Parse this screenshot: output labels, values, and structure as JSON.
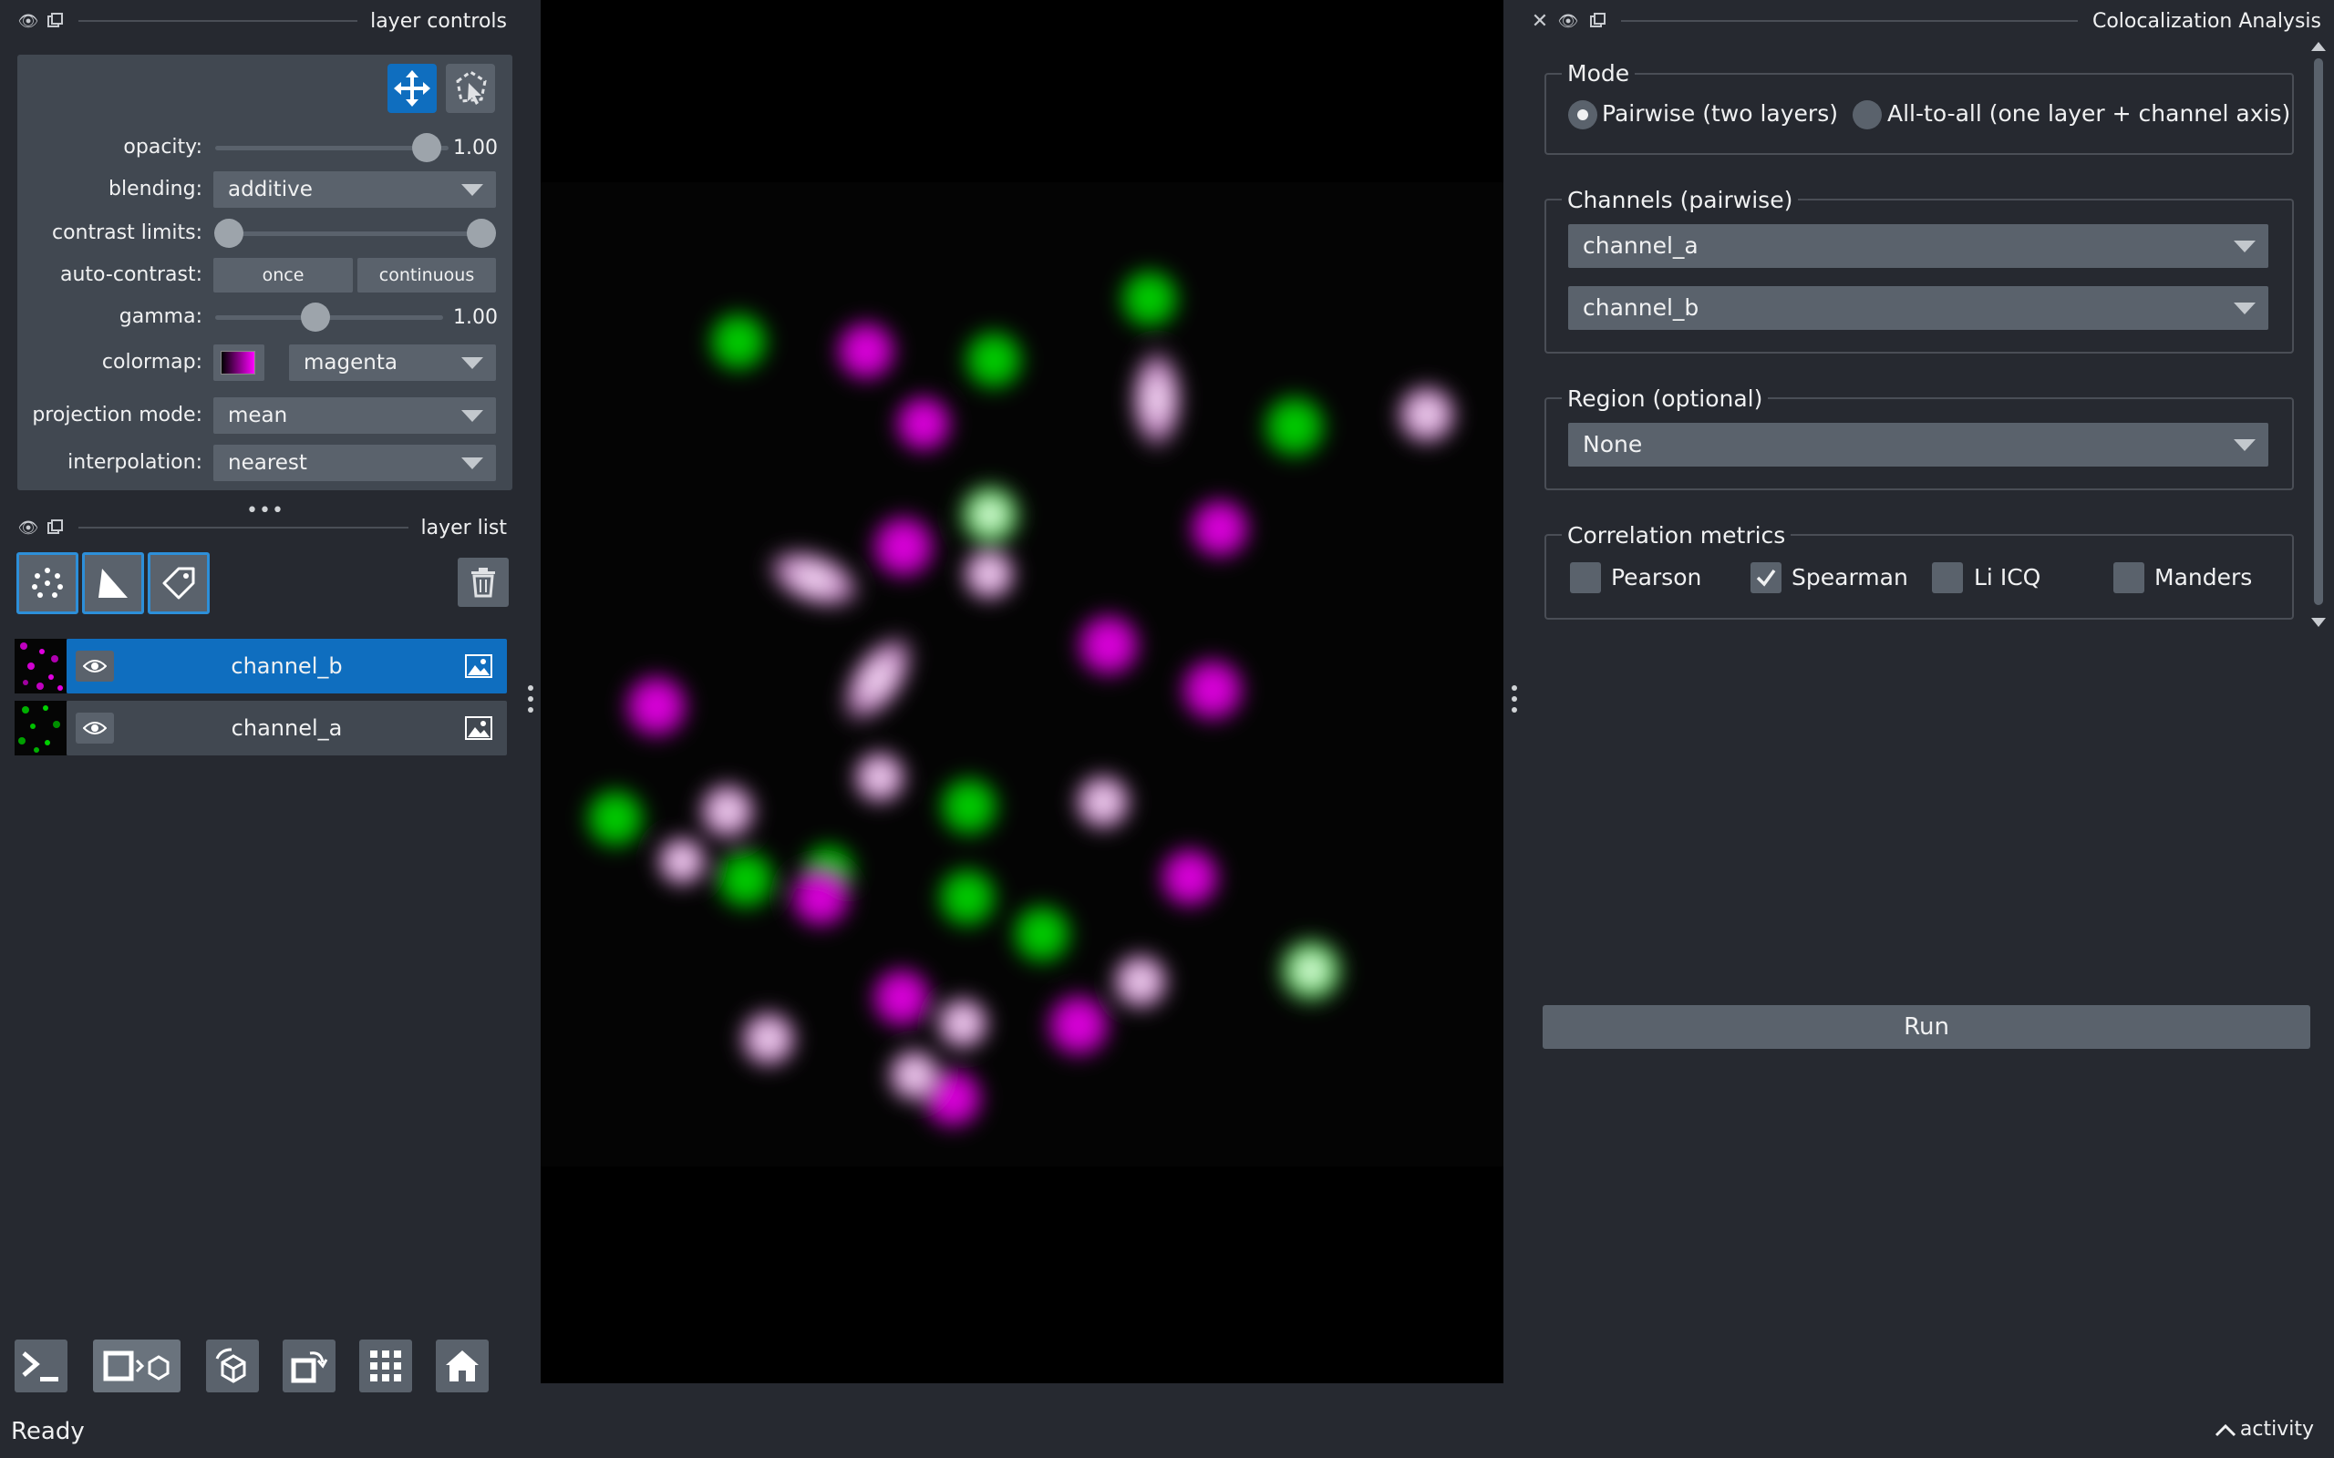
{
  "layer_controls": {
    "title": "layer controls",
    "opacity_label": "opacity:",
    "opacity_value": "1.00",
    "opacity_level": 1.0,
    "blending_label": "blending:",
    "blending_value": "additive",
    "contrast_label": "contrast limits:",
    "autocontrast_label": "auto-contrast:",
    "once_label": "once",
    "continuous_label": "continuous",
    "gamma_label": "gamma:",
    "gamma_value": "1.00",
    "colormap_label": "colormap:",
    "colormap_value": "magenta",
    "projection_label": "projection mode:",
    "projection_value": "mean",
    "interpolation_label": "interpolation:",
    "interpolation_value": "nearest"
  },
  "layer_list": {
    "title": "layer list",
    "layers": [
      {
        "name": "channel_b",
        "selected": true
      },
      {
        "name": "channel_a",
        "selected": false
      }
    ]
  },
  "analysis": {
    "title": "Colocalization Analysis",
    "mode_title": "Mode",
    "mode_pairwise": "Pairwise (two layers)",
    "mode_all": "All-to-all (one layer + channel axis)",
    "channels_title": "Channels (pairwise)",
    "channel_1": "channel_a",
    "channel_2": "channel_b",
    "region_title": "Region (optional)",
    "region_value": "None",
    "metrics_title": "Correlation metrics",
    "metrics": [
      {
        "label": "Pearson",
        "checked": false
      },
      {
        "label": "Spearman",
        "checked": true
      },
      {
        "label": "Li ICQ",
        "checked": false
      },
      {
        "label": "Manders",
        "checked": false
      }
    ],
    "run_label": "Run"
  },
  "status": {
    "text": "Ready",
    "activity": "activity"
  },
  "colors": {
    "accent": "#0f6ebf",
    "accent_border": "#2d8fd9",
    "panel_bg": "#262930",
    "control_bg": "#414851",
    "widget_bg": "#5a626c",
    "green_channel": "#00c800",
    "magenta_channel": "#e600e6"
  }
}
